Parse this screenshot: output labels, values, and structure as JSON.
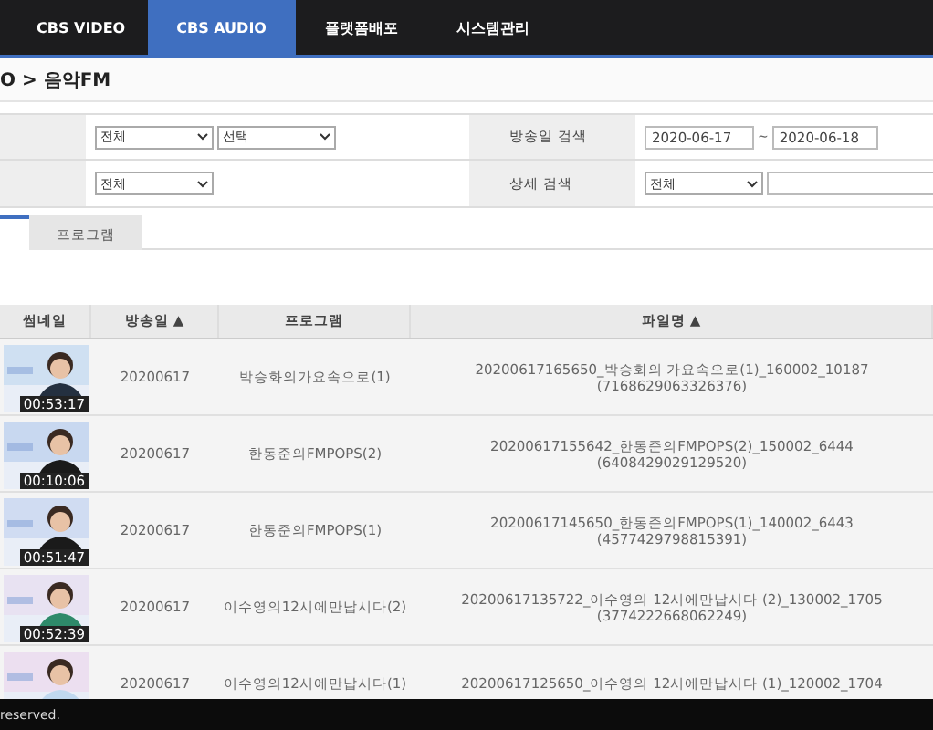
{
  "nav": {
    "tabs": [
      {
        "label": "CBS VIDEO",
        "selected": false
      },
      {
        "label": "CBS AUDIO",
        "selected": true
      },
      {
        "label": "플랫폼배포",
        "selected": false
      },
      {
        "label": "시스템관리",
        "selected": false
      }
    ]
  },
  "breadcrumb": "O > 음악FM",
  "search": {
    "row_1": {
      "selects": [
        "전체",
        "선택"
      ],
      "label": "방송일 검색",
      "date_from": "2020-06-17",
      "separator": "~",
      "date_to": "2020-06-18"
    },
    "row_2": {
      "selects": [
        "전체"
      ],
      "label": "상세 검색",
      "detail_select": "전체"
    }
  },
  "tabs": [
    {
      "selected": true
    },
    {
      "label": "프로그램",
      "selected": false
    }
  ],
  "table": {
    "columns": [
      "썸네일",
      "방송일 ▲",
      "프로그램",
      "파일명 ▲"
    ],
    "rows": [
      {
        "thumbnail": {
          "kind": "picture",
          "duration": "00:53:17"
        },
        "date": "20200617",
        "program": "박승화의가요속으로(1)",
        "file": "20200617165650_박승화의 가요속으로(1)_160002_10187",
        "file_id": "(7168629063326376)"
      },
      {
        "thumbnail": {
          "kind": "picture",
          "duration": "00:10:06"
        },
        "date": "20200617",
        "program": "한동준의FMPOPS(2)",
        "file": "20200617155642_한동준의FMPOPS(2)_150002_6444",
        "file_id": "(6408429029129520)"
      },
      {
        "thumbnail": {
          "kind": "picture",
          "duration": "00:51:47"
        },
        "date": "20200617",
        "program": "한동준의FMPOPS(1)",
        "file": "20200617145650_한동준의FMPOPS(1)_140002_6443",
        "file_id": "(4577429798815391)"
      },
      {
        "thumbnail": {
          "kind": "picture",
          "duration": "00:52:39"
        },
        "date": "20200617",
        "program": "이수영의12시에만납시다(2)",
        "file": "20200617135722_이수영의 12시에만납시다 (2)_130002_1705",
        "file_id": "(3774222668062249)"
      },
      {
        "date": "20200617",
        "program": "이수영의12시에만납시다(1)",
        "file": "20200617125650_이수영의 12시에만납시다 (1)_120002_1704"
      }
    ]
  },
  "footer": "reserved."
}
